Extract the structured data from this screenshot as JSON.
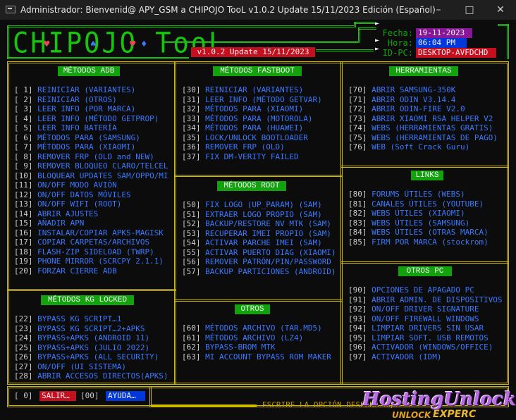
{
  "window": {
    "title": "Administrador:  Bienvenid@ APY_GSM a CHIPOJO TooL v1.0.2 Update 15/11/2023 Edición (Español)"
  },
  "logo": {
    "text": "CHIPOJO TooL"
  },
  "version": "v1.0.2 Update 15/11/2023",
  "info": {
    "fecha_label": "Fecha:",
    "fecha_value": "19-11-2023",
    "hora_label": "Hora:",
    "hora_value": "06:04 PM",
    "idpc_label": "ID-PC:",
    "idpc_value": "DESKTOP-AVFDCHD"
  },
  "colors": {
    "border": "#cdb900",
    "header_bg": "#13a10e",
    "number": "#cccccc",
    "label": "#3b78ff",
    "logo": "#16c60c",
    "red": "#c50f1f",
    "magenta": "#881798",
    "blue": "#0037da"
  },
  "sections": {
    "adb": {
      "title": "MÉTODOS ADB",
      "items": [
        [
          "[ 1]",
          "REINICIAR (VARIANTES)"
        ],
        [
          "[ 2]",
          "REINICIAR (OTROS)"
        ],
        [
          "[ 3]",
          "LEER INFO (POR MARCA)"
        ],
        [
          "[ 4]",
          "LEER INFO (MÉTODO GETPROP)"
        ],
        [
          "[ 5]",
          "LEER INFO BATERÍA"
        ],
        [
          "[ 6]",
          "MÉTODOS PARA (SAMSUNG)"
        ],
        [
          "[ 7]",
          "MÉTODOS PARA (XIAOMI)"
        ],
        [
          "[ 8]",
          "REMOVER FRP (OLD and NEW)"
        ],
        [
          "[ 9]",
          "REMOVER BLOQUEO CLARO/TELCEL"
        ],
        [
          "[10]",
          "BLOQUEAR UPDATES SAM/OPPO/MI"
        ],
        [
          "[11]",
          "ON/OFF MODO AVIÓN"
        ],
        [
          "[12]",
          "ON/OFF DATOS MÓVILES"
        ],
        [
          "[13]",
          "ON/OFF WIFI (ROOT)"
        ],
        [
          "[14]",
          "ABRIR AJUSTES"
        ],
        [
          "[15]",
          "AÑADIR APN"
        ],
        [
          "[16]",
          "INSTALAR/COPIAR APKS-MAGISK"
        ],
        [
          "[17]",
          "COPIAR CARPETAS/ARCHIVOS"
        ],
        [
          "[18]",
          "FLASH-ZIP SIDELOAD (TWRP)"
        ],
        [
          "[19]",
          "PHONE MIRROR (SCRCPY 2.1.1)"
        ],
        [
          "[20]",
          "FORZAR CIERRE ADB"
        ]
      ]
    },
    "kg": {
      "title": "MÉTODOS KG LOCKED",
      "items": [
        [
          "[22]",
          "BYPASS KG SCRIPT…1"
        ],
        [
          "[23]",
          "BYPASS KG SCRIPT…2+APKS"
        ],
        [
          "[24]",
          "BYPASS+APKS (ANDROID 11)"
        ],
        [
          "[25]",
          "BYPASS+APKS (JULIO 2022)"
        ],
        [
          "[26]",
          "BYPASS+APKS (ALL SECURITY)"
        ],
        [
          "[27]",
          "ON/OFF (UI SISTEMA)"
        ],
        [
          "[28]",
          "ABRIR ACCESOS DIRECTOS(APKS)"
        ]
      ]
    },
    "fastboot": {
      "title": "MÉTODOS FASTBOOT",
      "items": [
        [
          "[30]",
          "REINICIAR (VARIANTES)"
        ],
        [
          "[31]",
          "LEER INFO (MÉTODO GETVAR)"
        ],
        [
          "[32]",
          "MÉTODOS PARA (XIAOMI)"
        ],
        [
          "[33]",
          "MÉTODOS PARA (MOTOROLA)"
        ],
        [
          "[34]",
          "MÉTODOS PARA (HUAWEI)"
        ],
        [
          "[35]",
          "LOCK/UNLOCK BOOTLOADER"
        ],
        [
          "[36]",
          "REMOVER FRP (OLD)"
        ],
        [
          "[37]",
          "FIX DM-VERITY FAILED"
        ]
      ]
    },
    "root": {
      "title": "MÉTODOS ROOT",
      "items": [
        [
          "[50]",
          "FIX LOGO (UP_PARAM) (SAM)"
        ],
        [
          "[51]",
          "EXTRAER LOGO PROPIO (SAM)"
        ],
        [
          "[52]",
          "BACKUP/RESTORE NV MTK (SAM)"
        ],
        [
          "[53]",
          "RECUPERAR IMEI PROPIO (SAM)"
        ],
        [
          "[54]",
          "ACTIVAR PARCHE IMEI (SAM)"
        ],
        [
          "[55]",
          "ACTIVAR PUERTO DIAG (XIAOMI)"
        ],
        [
          "[56]",
          "REMOVER PATRÓN/PIN/PASSWORD"
        ],
        [
          "[57]",
          "BACKUP PARTICIONES (ANDROID)"
        ]
      ]
    },
    "otros": {
      "title": "OTROS",
      "items": [
        [
          "[60]",
          "MÉTODOS ARCHIVO (TAR.MD5)"
        ],
        [
          "[61]",
          "MÉTODOS ARCHIVO (LZ4)"
        ],
        [
          "[62]",
          "BYPASS-BROM MTK"
        ],
        [
          "[63]",
          "MI ACCOUNT BYPASS ROM MAKER"
        ]
      ]
    },
    "herramientas": {
      "title": "HERRAMIENTAS",
      "items": [
        [
          "[70]",
          "ABRIR SAMSUNG-350K"
        ],
        [
          "[71]",
          "ABRIR ODIN V3.14.4"
        ],
        [
          "[72]",
          "ABRIR ODIN-FIRE V2.0"
        ],
        [
          "[73]",
          "ABRIR XIAOMI RSA HELPER V2"
        ],
        [
          "[74]",
          "WEBS (HERRAMIENTAS GRATIS)"
        ],
        [
          "[75]",
          "WEBS (HERRAMIENTAS DE PAGO)"
        ],
        [
          "[76]",
          "WEB (Soft Crack Guru)"
        ]
      ]
    },
    "links": {
      "title": "LINKS",
      "items": [
        [
          "[80]",
          "FORUMS ÚTILES (WEBS)"
        ],
        [
          "[81]",
          "CANALES ÚTILES (YOUTUBE)"
        ],
        [
          "[82]",
          "WEBS ÚTILES (XIAOMI)"
        ],
        [
          "[83]",
          "WEBS ÚTILES (SAMSUNG)"
        ],
        [
          "[84]",
          "WEBS ÚTILES (OTRAS MARCA)"
        ],
        [
          "[85]",
          "FIRM POR MARCA (stockrom)"
        ]
      ]
    },
    "otrospc": {
      "title": "OTROS PC",
      "items": [
        [
          "[90]",
          "OPCIONES DE APAGADO PC"
        ],
        [
          "[91]",
          "ABRIR ADMIN. DE DISPOSITIVOS"
        ],
        [
          "[92]",
          "ON/OFF DRIVER SIGNATURE"
        ],
        [
          "[93]",
          "ON/OFF FIREWALL WINDOWS"
        ],
        [
          "[94]",
          "LIMPIAR DRIVERS SIN USAR"
        ],
        [
          "[95]",
          "LIMPIAR SOFT. USB REMOTOS"
        ],
        [
          "[96]",
          "ACTIVADOR (WINDOWS/OFFICE)"
        ],
        [
          "[97]",
          "ACTIVADOR (IDM)"
        ]
      ]
    }
  },
  "footer": {
    "exit_num": "[ 0]",
    "exit_label": "SALIR…",
    "help_num": "[00]",
    "help_label": "AYUDA…",
    "prompt": "ESCRIBE LA OPCIÓN DESEADA AQUÍ : "
  },
  "watermark": {
    "line1": "HostingUnlock",
    "line2_a": "UNLOCK",
    "line2_b": "EXPERC"
  }
}
